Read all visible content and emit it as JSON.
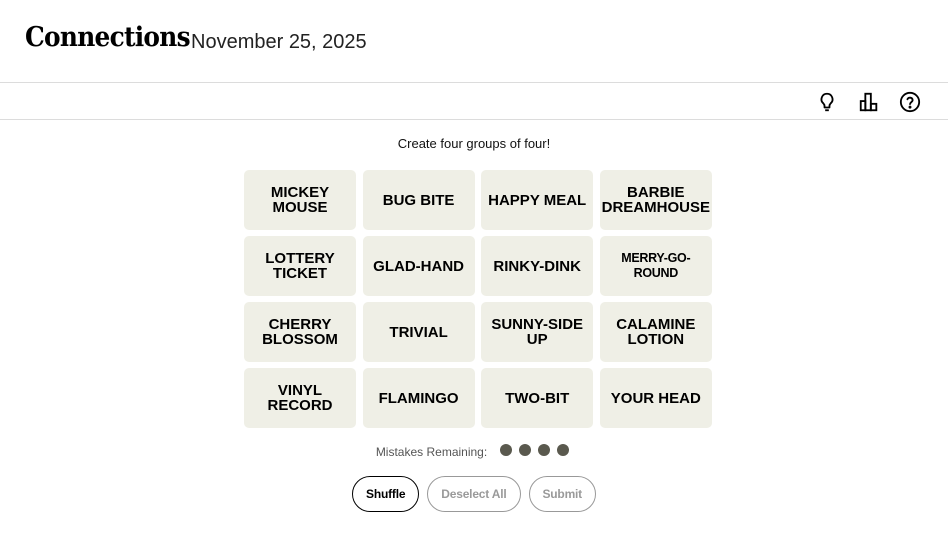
{
  "header": {
    "title": "Connections",
    "date": "November 25, 2025"
  },
  "toolbar": {
    "icons": [
      "lightbulb-icon",
      "stats-icon",
      "help-icon"
    ]
  },
  "game": {
    "instruction": "Create four groups of four!",
    "cards": [
      "MICKEY MOUSE",
      "BUG BITE",
      "HAPPY MEAL",
      "BARBIE DREAMHOUSE",
      "LOTTERY TICKET",
      "GLAD-HAND",
      "RINKY-DINK",
      "MERRY-GO-ROUND",
      "CHERRY BLOSSOM",
      "TRIVIAL",
      "SUNNY-SIDE UP",
      "CALAMINE LOTION",
      "VINYL RECORD",
      "FLAMINGO",
      "TWO-BIT",
      "YOUR HEAD"
    ],
    "mistakes_label": "Mistakes Remaining:",
    "mistakes_remaining": 4
  },
  "actions": {
    "shuffle_label": "Shuffle",
    "deselect_label": "Deselect All",
    "submit_label": "Submit"
  },
  "colors": {
    "card_bg": "#efefe6",
    "dot": "#5a594e"
  }
}
